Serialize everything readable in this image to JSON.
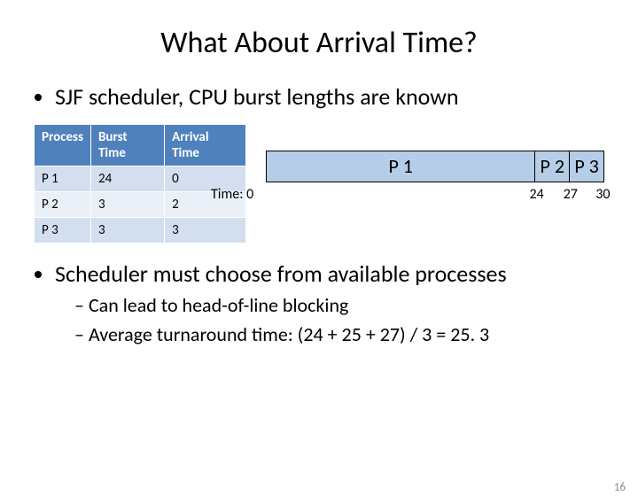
{
  "title": "What About Arrival Time?",
  "bullet1": "SJF scheduler, CPU burst lengths are known",
  "table": {
    "headers": {
      "c0": "Process",
      "c1": "Burst Time",
      "c2": "Arrival Time"
    },
    "rows": [
      {
        "p": "P 1",
        "bt": "24",
        "at": "0"
      },
      {
        "p": "P 2",
        "bt": "3",
        "at": "2"
      },
      {
        "p": "P 3",
        "bt": "3",
        "at": "3"
      }
    ]
  },
  "gantt": {
    "time_label": "Time: 0",
    "segments": [
      {
        "label": "P 1",
        "width": 24
      },
      {
        "label": "P 2",
        "width": 3
      },
      {
        "label": "P 3",
        "width": 3
      }
    ],
    "ticks": {
      "t24": "24",
      "t27": "27",
      "t30": "30"
    }
  },
  "bullet2": "Scheduler must choose from available processes",
  "sub1": "Can lead to head-of-line blocking",
  "sub2": "Average turnaround time: (24 + 25 + 27) / 3 = 25. 3",
  "page": "16",
  "chart_data": {
    "type": "table",
    "title": "SJF with arrival times — process burst/arrival table and resulting Gantt timeline",
    "columns": [
      "Process",
      "Burst Time",
      "Arrival Time"
    ],
    "rows": [
      [
        "P 1",
        24,
        0
      ],
      [
        "P 2",
        3,
        2
      ],
      [
        "P 3",
        3,
        3
      ]
    ],
    "gantt": {
      "order": [
        "P 1",
        "P 2",
        "P 3"
      ],
      "boundaries": [
        0,
        24,
        27,
        30
      ]
    },
    "average_turnaround": 25.3
  }
}
